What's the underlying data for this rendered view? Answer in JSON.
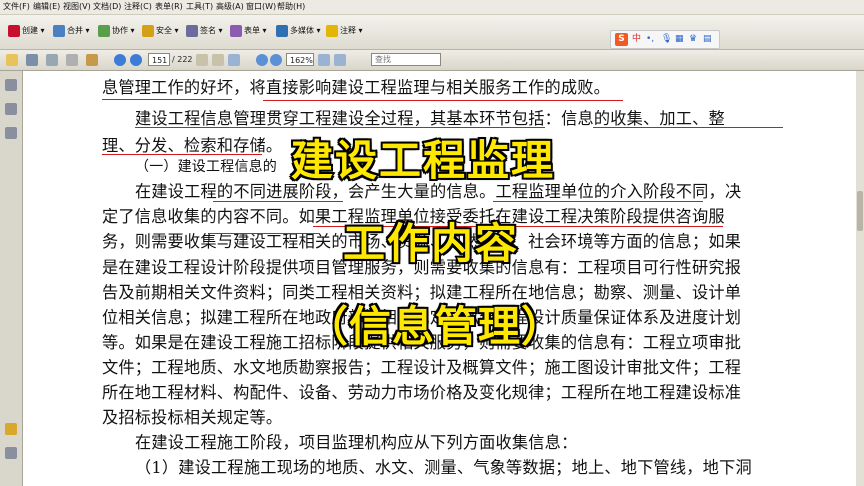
{
  "menubar": [
    "文件(F)",
    "编辑(E)",
    "视图(V)",
    "文档(D)",
    "注释(C)",
    "表单(R)",
    "工具(T)",
    "高级(A)",
    "窗口(W)",
    "帮助(H)"
  ],
  "toolbar": {
    "create": "创建",
    "combine": "合并",
    "collaborate": "协作",
    "secure": "安全",
    "sign": "签名",
    "forms": "表单",
    "multimedia": "多媒体",
    "comment": "注释"
  },
  "ime": {
    "logo": "S",
    "mode": "中"
  },
  "nav": {
    "current_page": "151",
    "total_pages": "/ 222",
    "zoom": "162%",
    "search_placeholder": "查找"
  },
  "document": {
    "lines": [
      "息管理工作的好坏，将直接影响建设工程监理与相关服务工作的成败。",
      "建设工程信息管理贯穿工程建设全过程，其基本环节包括：信息的收集、加工、整",
      "理、分发、检索和存储。",
      "（一）建设工程信息的",
      "在建设工程的不同进展阶段，会产生大量的信息。工程监理单位的介入阶段不同，决",
      "定了信息收集的内容不同。如果工程监理单位接受委托在建设工程决策阶段提供咨询服",
      "务，则需要收集与建设工程相关的市场、资源、自然环境、社会环境等方面的信息；如果",
      "是在建设工程设计阶段提供项目管理服务，则需要收集的信息有：工程项目可行性研究报",
      "告及前期相关文件资料；同类工程相关资料；拟建工程所在地信息；勘察、测量、设计单",
      "位相关信息；拟建工程所在地政府部门相关规定；拟建工程设计质量保证体系及进度计划",
      "等。如果是在建设工程施工招标阶段提供相关服务，则需要收集的信息有：工程立项审批",
      "文件；工程地质、水文地质勘察报告；工程设计及概算文件；施工图设计审批文件；工程",
      "所在地工程材料、构配件、设备、劳动力市场价格及变化规律；工程所在地工程建设标准",
      "及招标投标相关规定等。",
      "在建设工程施工阶段，项目监理机构应从下列方面收集信息：",
      "（1）建设工程施工现场的地质、水文、测量、气象等数据；地上、地下管线，地下洞"
    ]
  },
  "overlay": {
    "title1": "建设工程监理",
    "title2": "工作内容",
    "title3": "（信息管理）"
  },
  "colors": {
    "overlay_text": "#ffe800",
    "annotation_red": "#d21a1a"
  }
}
